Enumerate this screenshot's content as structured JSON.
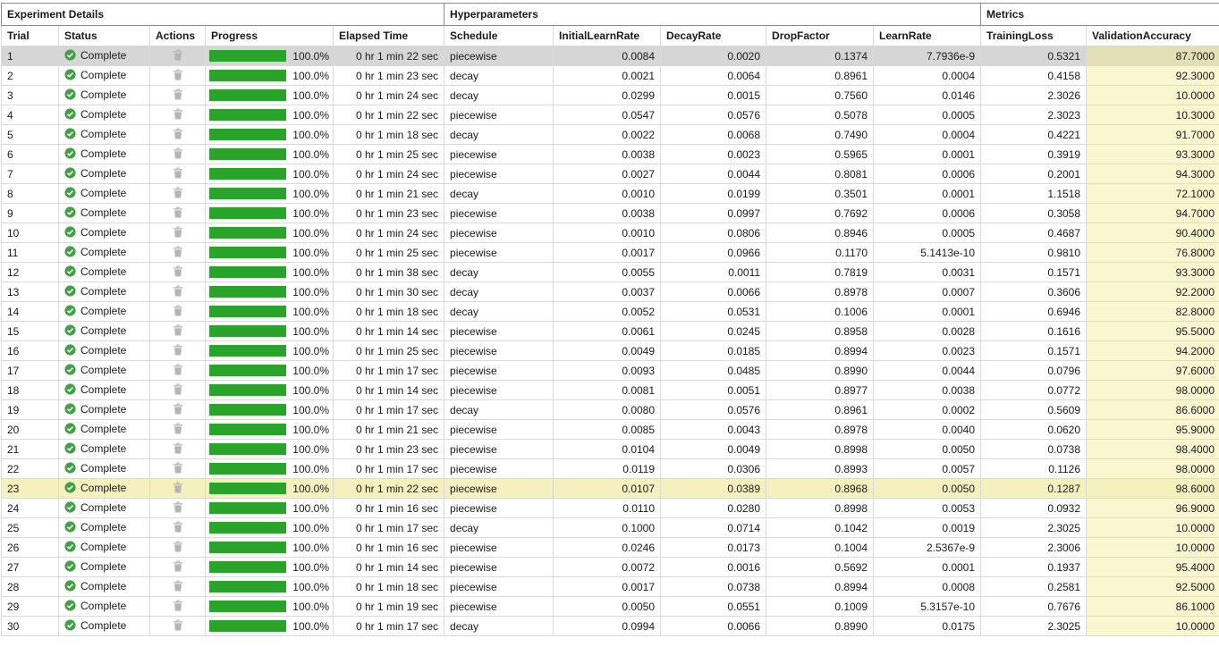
{
  "table": {
    "groups": [
      {
        "label": "Experiment Details",
        "span": 5
      },
      {
        "label": "Hyperparameters",
        "span": 5
      },
      {
        "label": "Metrics",
        "span": 2
      }
    ],
    "columns": [
      "Trial",
      "Status",
      "Actions",
      "Progress",
      "Elapsed Time",
      "Schedule",
      "InitialLearnRate",
      "DecayRate",
      "DropFactor",
      "LearnRate",
      "TrainingLoss",
      "ValidationAccuracy"
    ],
    "colors": {
      "progress_green": "#2aa32a",
      "check_green": "#43a047",
      "trash_gray": "#b5b5b5",
      "validation_column_yellow": "#f9f6d0",
      "highlight_row_yellow": "#f5f1bf",
      "selected_row_gray": "#d6d6d6"
    },
    "rows": [
      {
        "trial": 1,
        "status": "Complete",
        "progress": "100.0%",
        "elapsed": "0 hr 1 min 22 sec",
        "schedule": "piecewise",
        "initial_learn_rate": "0.0084",
        "decay_rate": "0.0020",
        "drop_factor": "0.1374",
        "learn_rate": "7.7936e-9",
        "training_loss": "0.5321",
        "validation_accuracy": "87.7000",
        "selected": true
      },
      {
        "trial": 2,
        "status": "Complete",
        "progress": "100.0%",
        "elapsed": "0 hr 1 min 23 sec",
        "schedule": "decay",
        "initial_learn_rate": "0.0021",
        "decay_rate": "0.0064",
        "drop_factor": "0.8961",
        "learn_rate": "0.0004",
        "training_loss": "0.4158",
        "validation_accuracy": "92.3000"
      },
      {
        "trial": 3,
        "status": "Complete",
        "progress": "100.0%",
        "elapsed": "0 hr 1 min 24 sec",
        "schedule": "decay",
        "initial_learn_rate": "0.0299",
        "decay_rate": "0.0015",
        "drop_factor": "0.7560",
        "learn_rate": "0.0146",
        "training_loss": "2.3026",
        "validation_accuracy": "10.0000"
      },
      {
        "trial": 4,
        "status": "Complete",
        "progress": "100.0%",
        "elapsed": "0 hr 1 min 22 sec",
        "schedule": "piecewise",
        "initial_learn_rate": "0.0547",
        "decay_rate": "0.0576",
        "drop_factor": "0.5078",
        "learn_rate": "0.0005",
        "training_loss": "2.3023",
        "validation_accuracy": "10.3000"
      },
      {
        "trial": 5,
        "status": "Complete",
        "progress": "100.0%",
        "elapsed": "0 hr 1 min 18 sec",
        "schedule": "decay",
        "initial_learn_rate": "0.0022",
        "decay_rate": "0.0068",
        "drop_factor": "0.7490",
        "learn_rate": "0.0004",
        "training_loss": "0.4221",
        "validation_accuracy": "91.7000"
      },
      {
        "trial": 6,
        "status": "Complete",
        "progress": "100.0%",
        "elapsed": "0 hr 1 min 25 sec",
        "schedule": "piecewise",
        "initial_learn_rate": "0.0038",
        "decay_rate": "0.0023",
        "drop_factor": "0.5965",
        "learn_rate": "0.0001",
        "training_loss": "0.3919",
        "validation_accuracy": "93.3000"
      },
      {
        "trial": 7,
        "status": "Complete",
        "progress": "100.0%",
        "elapsed": "0 hr 1 min 24 sec",
        "schedule": "piecewise",
        "initial_learn_rate": "0.0027",
        "decay_rate": "0.0044",
        "drop_factor": "0.8081",
        "learn_rate": "0.0006",
        "training_loss": "0.2001",
        "validation_accuracy": "94.3000"
      },
      {
        "trial": 8,
        "status": "Complete",
        "progress": "100.0%",
        "elapsed": "0 hr 1 min 21 sec",
        "schedule": "decay",
        "initial_learn_rate": "0.0010",
        "decay_rate": "0.0199",
        "drop_factor": "0.3501",
        "learn_rate": "0.0001",
        "training_loss": "1.1518",
        "validation_accuracy": "72.1000"
      },
      {
        "trial": 9,
        "status": "Complete",
        "progress": "100.0%",
        "elapsed": "0 hr 1 min 23 sec",
        "schedule": "piecewise",
        "initial_learn_rate": "0.0038",
        "decay_rate": "0.0997",
        "drop_factor": "0.7692",
        "learn_rate": "0.0006",
        "training_loss": "0.3058",
        "validation_accuracy": "94.7000"
      },
      {
        "trial": 10,
        "status": "Complete",
        "progress": "100.0%",
        "elapsed": "0 hr 1 min 24 sec",
        "schedule": "piecewise",
        "initial_learn_rate": "0.0010",
        "decay_rate": "0.0806",
        "drop_factor": "0.8946",
        "learn_rate": "0.0005",
        "training_loss": "0.4687",
        "validation_accuracy": "90.4000"
      },
      {
        "trial": 11,
        "status": "Complete",
        "progress": "100.0%",
        "elapsed": "0 hr 1 min 25 sec",
        "schedule": "piecewise",
        "initial_learn_rate": "0.0017",
        "decay_rate": "0.0966",
        "drop_factor": "0.1170",
        "learn_rate": "5.1413e-10",
        "training_loss": "0.9810",
        "validation_accuracy": "76.8000"
      },
      {
        "trial": 12,
        "status": "Complete",
        "progress": "100.0%",
        "elapsed": "0 hr 1 min 38 sec",
        "schedule": "decay",
        "initial_learn_rate": "0.0055",
        "decay_rate": "0.0011",
        "drop_factor": "0.7819",
        "learn_rate": "0.0031",
        "training_loss": "0.1571",
        "validation_accuracy": "93.3000"
      },
      {
        "trial": 13,
        "status": "Complete",
        "progress": "100.0%",
        "elapsed": "0 hr 1 min 30 sec",
        "schedule": "decay",
        "initial_learn_rate": "0.0037",
        "decay_rate": "0.0066",
        "drop_factor": "0.8978",
        "learn_rate": "0.0007",
        "training_loss": "0.3606",
        "validation_accuracy": "92.2000"
      },
      {
        "trial": 14,
        "status": "Complete",
        "progress": "100.0%",
        "elapsed": "0 hr 1 min 18 sec",
        "schedule": "decay",
        "initial_learn_rate": "0.0052",
        "decay_rate": "0.0531",
        "drop_factor": "0.1006",
        "learn_rate": "0.0001",
        "training_loss": "0.6946",
        "validation_accuracy": "82.8000"
      },
      {
        "trial": 15,
        "status": "Complete",
        "progress": "100.0%",
        "elapsed": "0 hr 1 min 14 sec",
        "schedule": "piecewise",
        "initial_learn_rate": "0.0061",
        "decay_rate": "0.0245",
        "drop_factor": "0.8958",
        "learn_rate": "0.0028",
        "training_loss": "0.1616",
        "validation_accuracy": "95.5000"
      },
      {
        "trial": 16,
        "status": "Complete",
        "progress": "100.0%",
        "elapsed": "0 hr 1 min 25 sec",
        "schedule": "piecewise",
        "initial_learn_rate": "0.0049",
        "decay_rate": "0.0185",
        "drop_factor": "0.8994",
        "learn_rate": "0.0023",
        "training_loss": "0.1571",
        "validation_accuracy": "94.2000"
      },
      {
        "trial": 17,
        "status": "Complete",
        "progress": "100.0%",
        "elapsed": "0 hr 1 min 17 sec",
        "schedule": "piecewise",
        "initial_learn_rate": "0.0093",
        "decay_rate": "0.0485",
        "drop_factor": "0.8990",
        "learn_rate": "0.0044",
        "training_loss": "0.0796",
        "validation_accuracy": "97.6000"
      },
      {
        "trial": 18,
        "status": "Complete",
        "progress": "100.0%",
        "elapsed": "0 hr 1 min 14 sec",
        "schedule": "piecewise",
        "initial_learn_rate": "0.0081",
        "decay_rate": "0.0051",
        "drop_factor": "0.8977",
        "learn_rate": "0.0038",
        "training_loss": "0.0772",
        "validation_accuracy": "98.0000"
      },
      {
        "trial": 19,
        "status": "Complete",
        "progress": "100.0%",
        "elapsed": "0 hr 1 min 17 sec",
        "schedule": "decay",
        "initial_learn_rate": "0.0080",
        "decay_rate": "0.0576",
        "drop_factor": "0.8961",
        "learn_rate": "0.0002",
        "training_loss": "0.5609",
        "validation_accuracy": "86.6000"
      },
      {
        "trial": 20,
        "status": "Complete",
        "progress": "100.0%",
        "elapsed": "0 hr 1 min 21 sec",
        "schedule": "piecewise",
        "initial_learn_rate": "0.0085",
        "decay_rate": "0.0043",
        "drop_factor": "0.8978",
        "learn_rate": "0.0040",
        "training_loss": "0.0620",
        "validation_accuracy": "95.9000"
      },
      {
        "trial": 21,
        "status": "Complete",
        "progress": "100.0%",
        "elapsed": "0 hr 1 min 23 sec",
        "schedule": "piecewise",
        "initial_learn_rate": "0.0104",
        "decay_rate": "0.0049",
        "drop_factor": "0.8998",
        "learn_rate": "0.0050",
        "training_loss": "0.0738",
        "validation_accuracy": "98.4000"
      },
      {
        "trial": 22,
        "status": "Complete",
        "progress": "100.0%",
        "elapsed": "0 hr 1 min 17 sec",
        "schedule": "piecewise",
        "initial_learn_rate": "0.0119",
        "decay_rate": "0.0306",
        "drop_factor": "0.8993",
        "learn_rate": "0.0057",
        "training_loss": "0.1126",
        "validation_accuracy": "98.0000"
      },
      {
        "trial": 23,
        "status": "Complete",
        "progress": "100.0%",
        "elapsed": "0 hr 1 min 22 sec",
        "schedule": "piecewise",
        "initial_learn_rate": "0.0107",
        "decay_rate": "0.0389",
        "drop_factor": "0.8968",
        "learn_rate": "0.0050",
        "training_loss": "0.1287",
        "validation_accuracy": "98.6000",
        "highlighted": true
      },
      {
        "trial": 24,
        "status": "Complete",
        "progress": "100.0%",
        "elapsed": "0 hr 1 min 16 sec",
        "schedule": "piecewise",
        "initial_learn_rate": "0.0110",
        "decay_rate": "0.0280",
        "drop_factor": "0.8998",
        "learn_rate": "0.0053",
        "training_loss": "0.0932",
        "validation_accuracy": "96.9000"
      },
      {
        "trial": 25,
        "status": "Complete",
        "progress": "100.0%",
        "elapsed": "0 hr 1 min 17 sec",
        "schedule": "decay",
        "initial_learn_rate": "0.1000",
        "decay_rate": "0.0714",
        "drop_factor": "0.1042",
        "learn_rate": "0.0019",
        "training_loss": "2.3025",
        "validation_accuracy": "10.0000"
      },
      {
        "trial": 26,
        "status": "Complete",
        "progress": "100.0%",
        "elapsed": "0 hr 1 min 16 sec",
        "schedule": "piecewise",
        "initial_learn_rate": "0.0246",
        "decay_rate": "0.0173",
        "drop_factor": "0.1004",
        "learn_rate": "2.5367e-9",
        "training_loss": "2.3006",
        "validation_accuracy": "10.0000"
      },
      {
        "trial": 27,
        "status": "Complete",
        "progress": "100.0%",
        "elapsed": "0 hr 1 min 14 sec",
        "schedule": "piecewise",
        "initial_learn_rate": "0.0072",
        "decay_rate": "0.0016",
        "drop_factor": "0.5692",
        "learn_rate": "0.0001",
        "training_loss": "0.1937",
        "validation_accuracy": "95.4000"
      },
      {
        "trial": 28,
        "status": "Complete",
        "progress": "100.0%",
        "elapsed": "0 hr 1 min 18 sec",
        "schedule": "piecewise",
        "initial_learn_rate": "0.0017",
        "decay_rate": "0.0738",
        "drop_factor": "0.8994",
        "learn_rate": "0.0008",
        "training_loss": "0.2581",
        "validation_accuracy": "92.5000"
      },
      {
        "trial": 29,
        "status": "Complete",
        "progress": "100.0%",
        "elapsed": "0 hr 1 min 19 sec",
        "schedule": "piecewise",
        "initial_learn_rate": "0.0050",
        "decay_rate": "0.0551",
        "drop_factor": "0.1009",
        "learn_rate": "5.3157e-10",
        "training_loss": "0.7676",
        "validation_accuracy": "86.1000"
      },
      {
        "trial": 30,
        "status": "Complete",
        "progress": "100.0%",
        "elapsed": "0 hr 1 min 17 sec",
        "schedule": "decay",
        "initial_learn_rate": "0.0994",
        "decay_rate": "0.0066",
        "drop_factor": "0.8990",
        "learn_rate": "0.0175",
        "training_loss": "2.3025",
        "validation_accuracy": "10.0000"
      }
    ]
  }
}
